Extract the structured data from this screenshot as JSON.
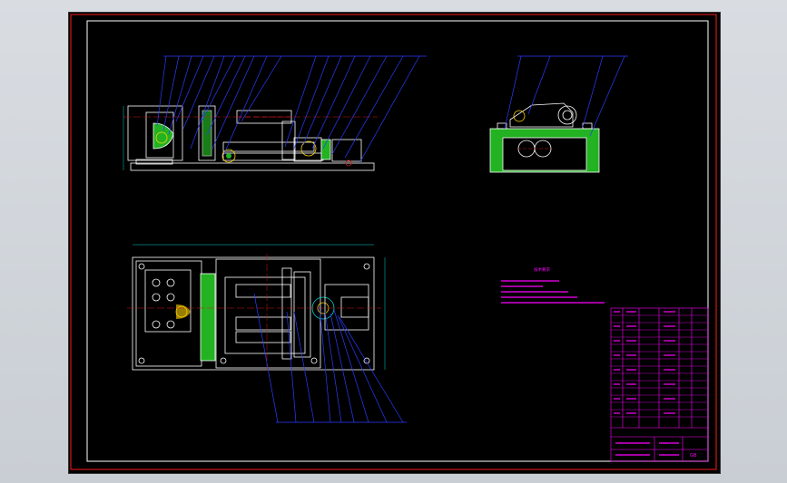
{
  "drawing": {
    "background": "#000000",
    "colors": {
      "outer_frame": "#d01818",
      "inner_frame": "#ffffff",
      "geometry": "#ffffff",
      "leader": "#2a3cff",
      "section_hatch": "#22b222",
      "center_line": "#d01818",
      "part_yellow": "#ffd400",
      "dimension": "#00d0d0",
      "notes": "#ff00ff"
    },
    "views": [
      "front-view",
      "side-view",
      "top-view"
    ],
    "tech_notes_heading": "技术要求",
    "title_block_code": "GB"
  }
}
